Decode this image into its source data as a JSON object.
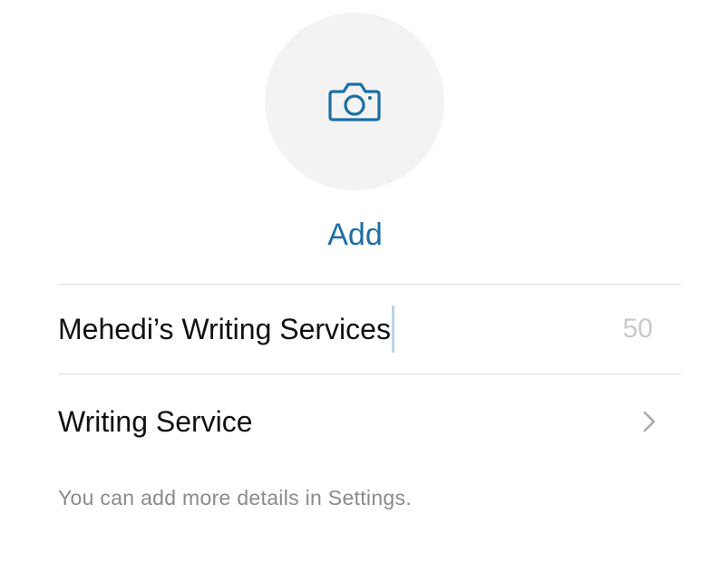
{
  "profile_photo": {
    "icon": "camera-icon",
    "add_label": "Add",
    "accent_color": "#1c6ea4"
  },
  "business_name": {
    "value": "Mehedi’s Writing Services",
    "remaining_chars": "50"
  },
  "category": {
    "label": "Writing Service",
    "icon": "chevron-right-icon"
  },
  "footer": {
    "note": "You can add more details in Settings."
  }
}
